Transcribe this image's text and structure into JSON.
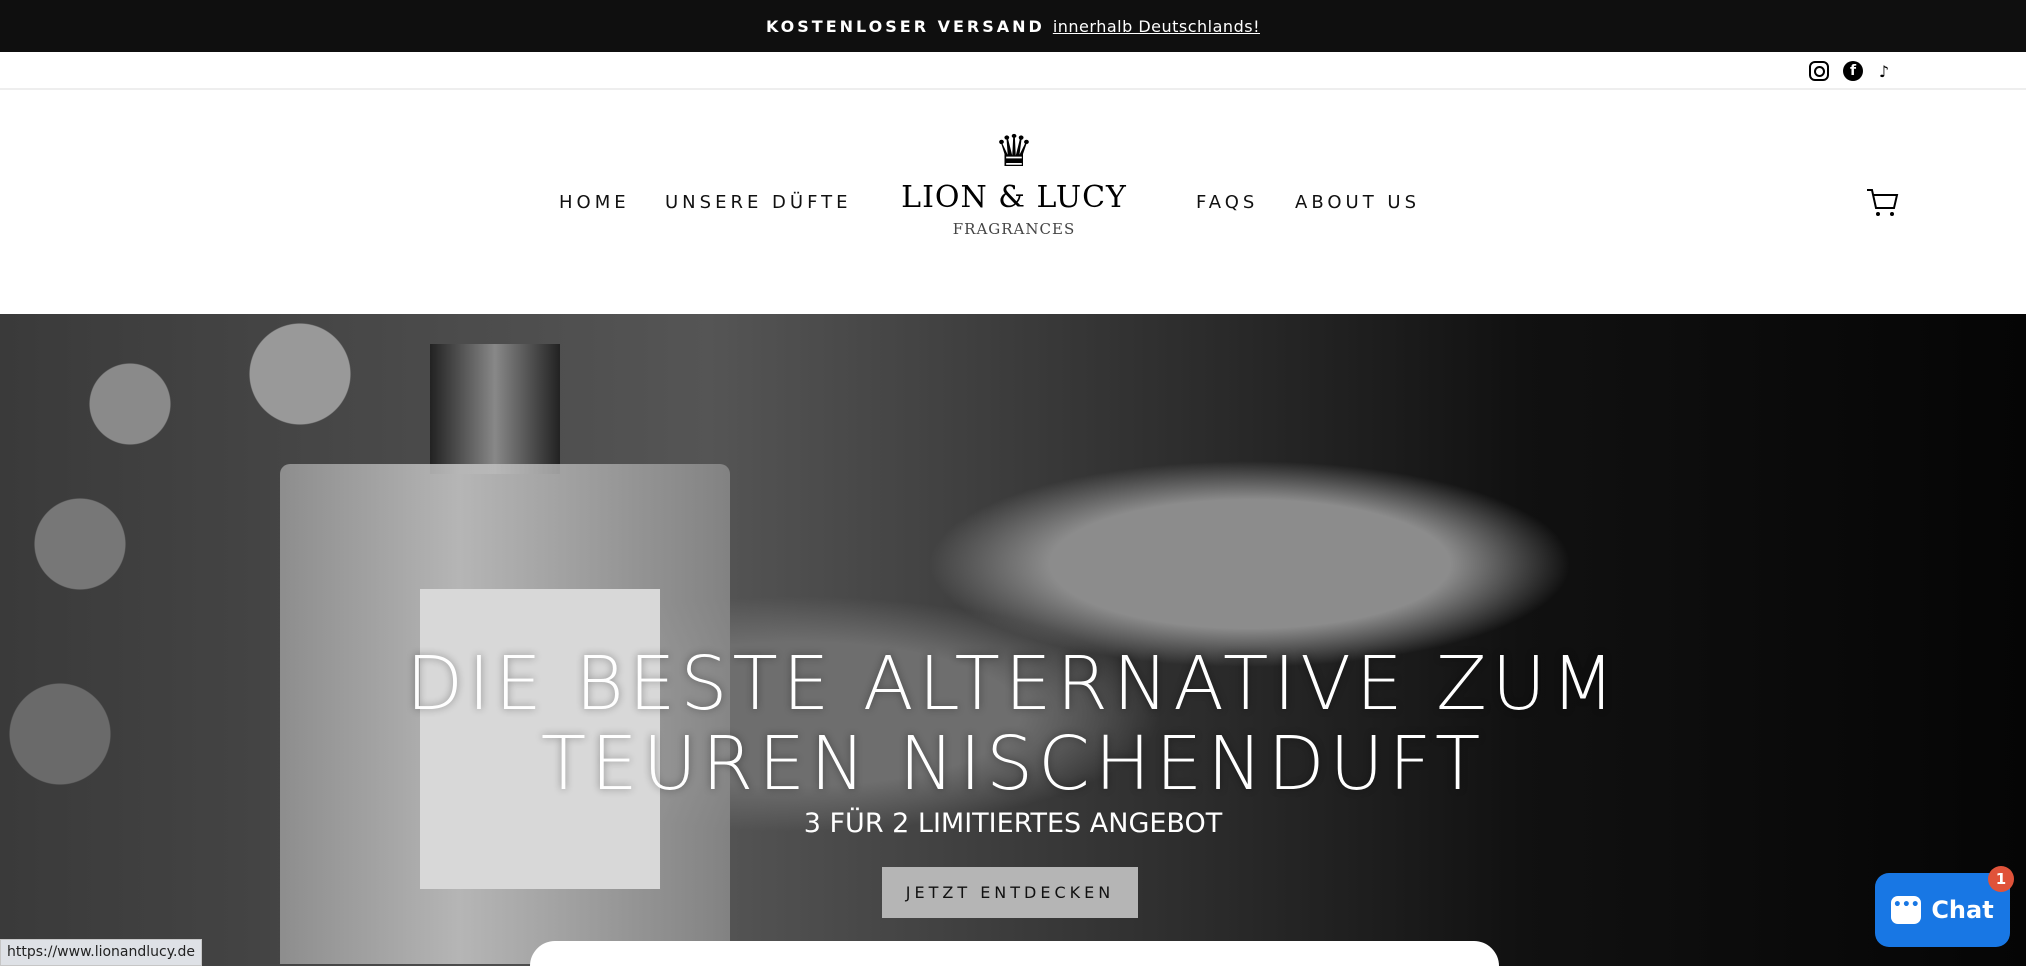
{
  "announcement": {
    "bold": "KOSTENLOSER VERSAND",
    "link": "innerhalb Deutschlands!"
  },
  "social": [
    "instagram-icon",
    "facebook-icon",
    "tiktok-icon"
  ],
  "nav": {
    "left": [
      "HOME",
      "UNSERE DÜFTE"
    ],
    "right": [
      "FAQS",
      "ABOUT US"
    ]
  },
  "logo": {
    "text": "LION & LUCY",
    "sub": "FRAGRANCES"
  },
  "hero": {
    "title": "DIE BESTE ALTERNATIVE ZUM TEUREN NISCHENDUFT",
    "subtitle": "3 FÜR 2 LIMITIERTES ANGEBOT",
    "cta": "JETZT ENTDECKEN"
  },
  "chat": {
    "label": "Chat",
    "badge": "1",
    "color": "#1877e4"
  },
  "status_url": "https://www.lionandlucy.de"
}
